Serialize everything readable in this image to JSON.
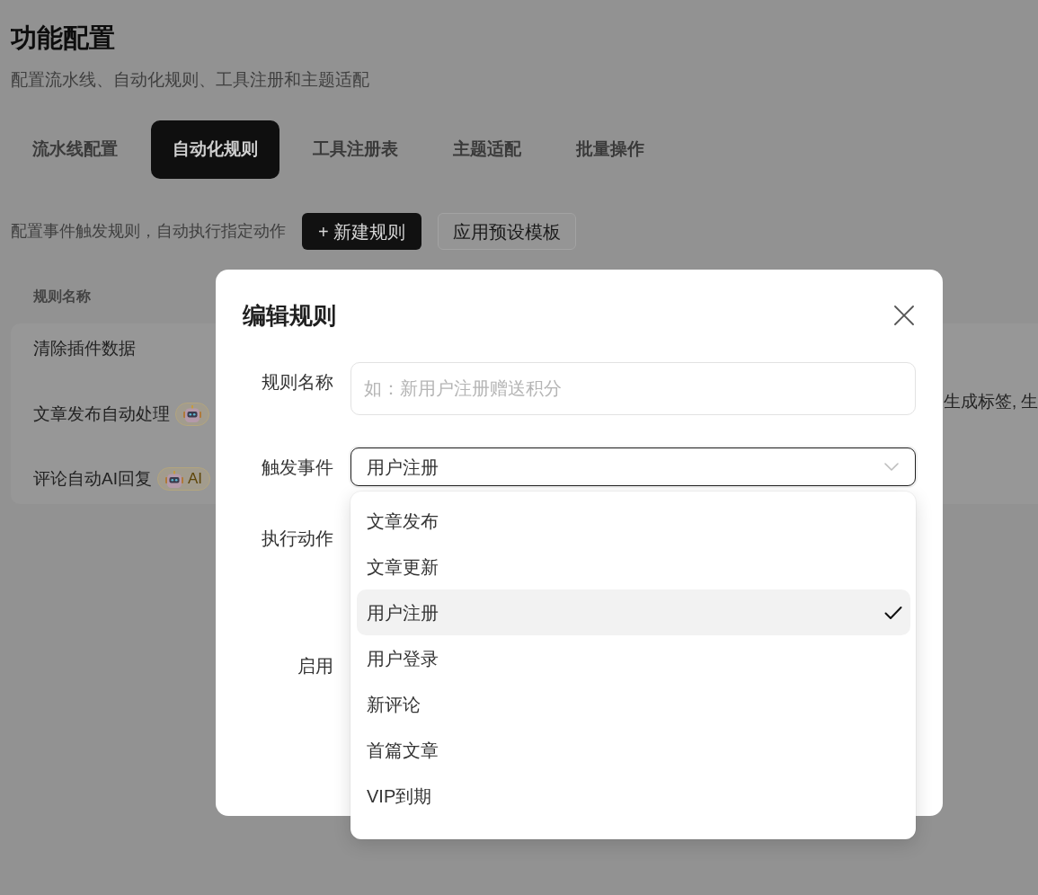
{
  "page": {
    "title": "功能配置",
    "subtitle": "配置流水线、自动化规则、工具注册和主题适配"
  },
  "tabs": [
    {
      "label": "流水线配置",
      "selected": false
    },
    {
      "label": "自动化规则",
      "selected": true
    },
    {
      "label": "工具注册表",
      "selected": false
    },
    {
      "label": "主题适配",
      "selected": false
    },
    {
      "label": "批量操作",
      "selected": false
    }
  ],
  "toolbar": {
    "description": "配置事件触发规则，自动执行指定动作",
    "buttons": [
      {
        "kind": "primary",
        "label": "+ 新建规则"
      },
      {
        "kind": "outline",
        "label": "应用预设模板"
      }
    ]
  },
  "table": {
    "columns": [
      {
        "label": "规则名称"
      }
    ],
    "rows": [
      {
        "name": "清除插件数据"
      },
      {
        "name": "文章发布自动处理",
        "badge": {
          "kind": "ai"
        },
        "trailing_column": "生成标签, 生"
      },
      {
        "name": "评论自动AI回复",
        "badge": {
          "kind": "ai",
          "label": "AI"
        }
      }
    ]
  },
  "modal": {
    "title": "编辑规则",
    "fields": [
      {
        "kind": "text",
        "label": "规则名称",
        "placeholder": "如：新用户注册赠送积分"
      },
      {
        "kind": "select",
        "label": "触发事件",
        "value": "用户注册",
        "expanded": true,
        "options": [
          {
            "label": "文章发布",
            "selected": false
          },
          {
            "label": "文章更新",
            "selected": false
          },
          {
            "label": "用户注册",
            "selected": true
          },
          {
            "label": "用户登录",
            "selected": false
          },
          {
            "label": "新评论",
            "selected": false
          },
          {
            "label": "首篇文章",
            "selected": false
          },
          {
            "label": "VIP到期",
            "selected": false
          }
        ]
      },
      {
        "kind": "label_only",
        "label": "执行动作"
      },
      {
        "kind": "label_only",
        "label": "启用"
      }
    ]
  }
}
